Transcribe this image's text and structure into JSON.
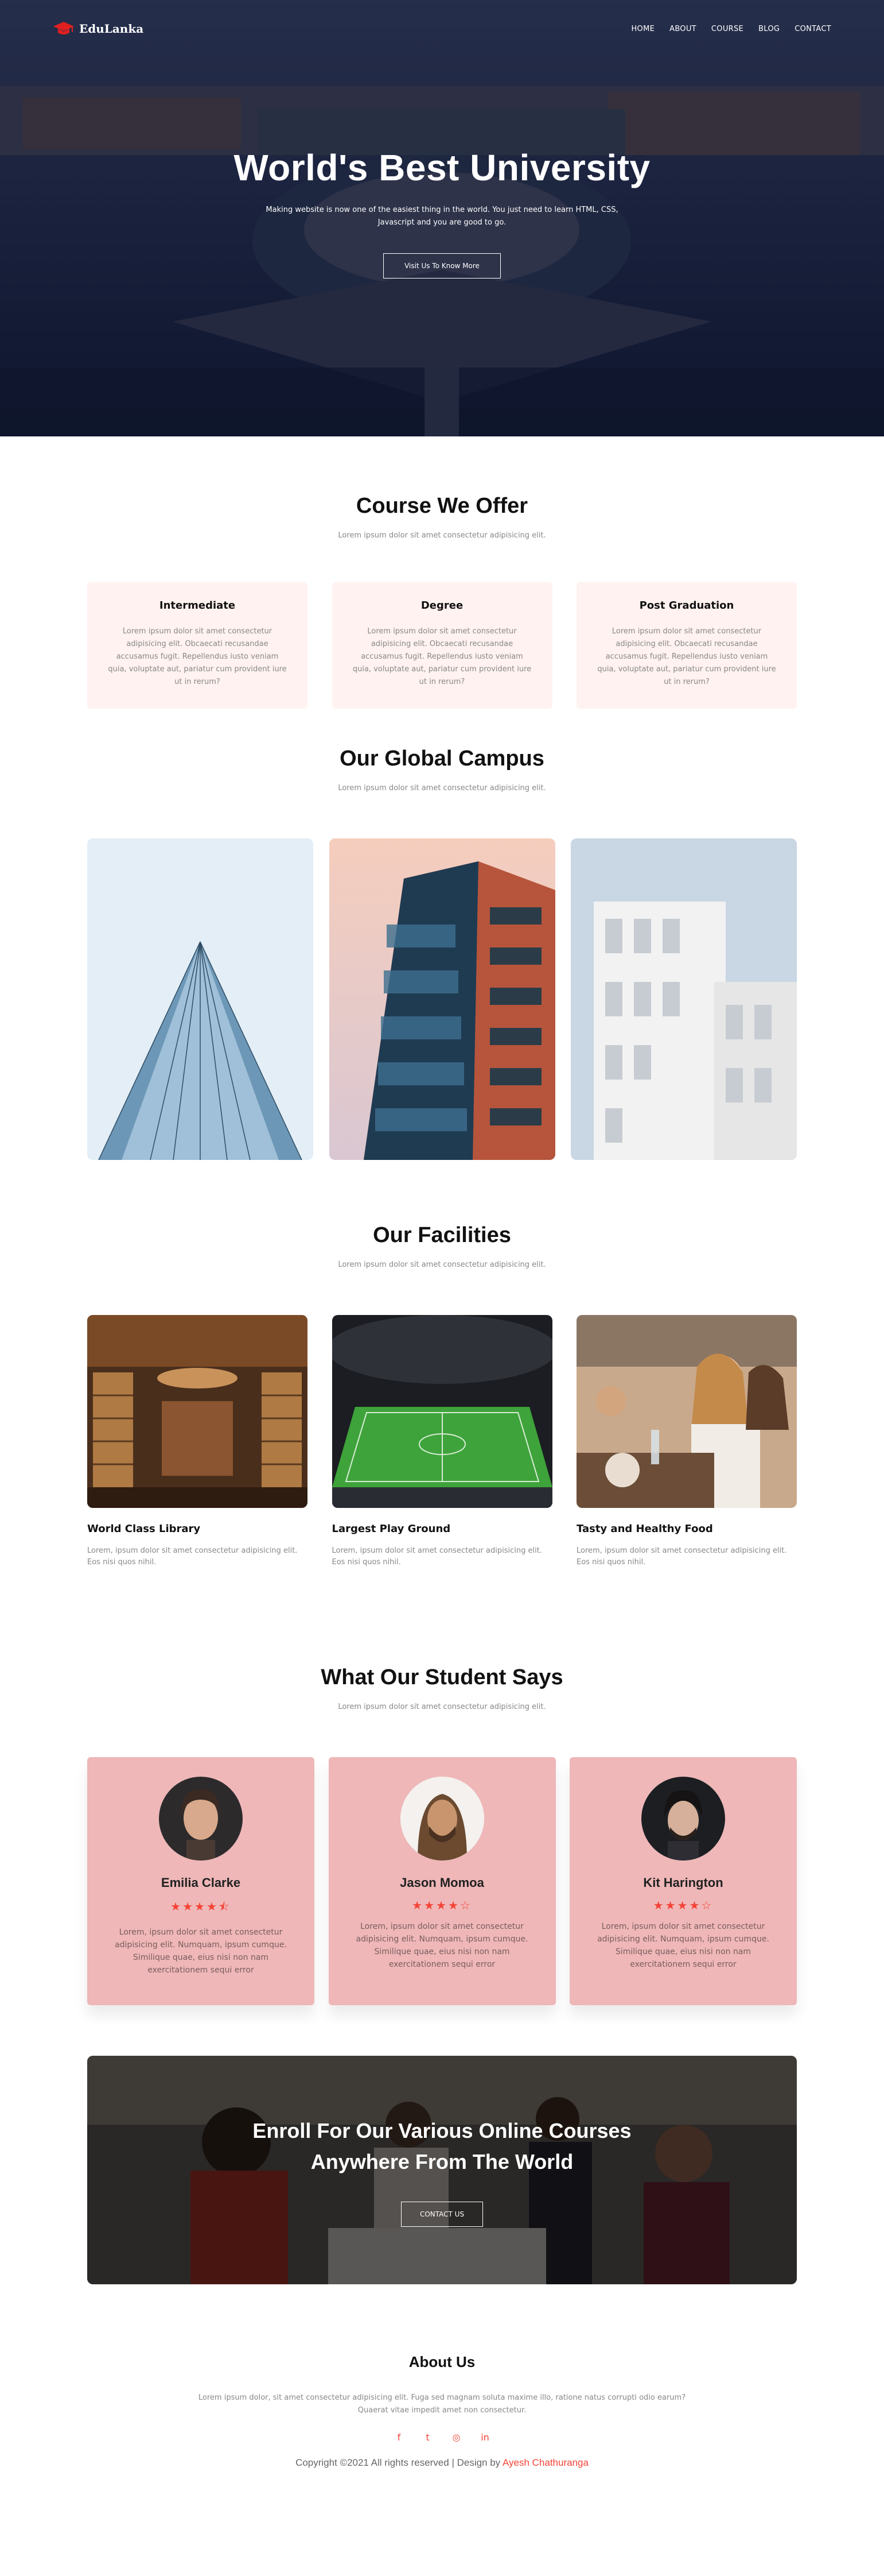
{
  "brand": {
    "name": "EduLanka",
    "accent_color": "#f44336",
    "icon": "graduation-cap-icon"
  },
  "nav": {
    "items": [
      "HOME",
      "ABOUT",
      "COURSE",
      "BLOG",
      "CONTACT"
    ]
  },
  "hero": {
    "title": "World's Best University",
    "subtitle": "Making website is now one of the easiest thing in the world. You just need to learn HTML, CSS, Javascript and you are good to go.",
    "button_label": "Visit Us To Know More"
  },
  "courses": {
    "title": "Course We Offer",
    "subtitle": "Lorem ipsum dolor sit amet consectetur adipisicing elit.",
    "cards": [
      {
        "name": "Intermediate",
        "text": "Lorem ipsum dolor sit amet consectetur adipisicing elit. Obcaecati recusandae accusamus fugit. Repellendus iusto veniam quia, voluptate aut, pariatur cum provident iure ut in rerum?"
      },
      {
        "name": "Degree",
        "text": "Lorem ipsum dolor sit amet consectetur adipisicing elit. Obcaecati recusandae accusamus fugit. Repellendus iusto veniam quia, voluptate aut, pariatur cum provident iure ut in rerum?"
      },
      {
        "name": "Post Graduation",
        "text": "Lorem ipsum dolor sit amet consectetur adipisicing elit. Obcaecati recusandae accusamus fugit. Repellendus iusto veniam quia, voluptate aut, pariatur cum provident iure ut in rerum?"
      }
    ]
  },
  "campus": {
    "title": "Our Global Campus",
    "subtitle": "Lorem ipsum dolor sit amet consectetur adipisicing elit."
  },
  "facilities": {
    "title": "Our Facilities",
    "subtitle": "Lorem ipsum dolor sit amet consectetur adipisicing elit.",
    "cards": [
      {
        "name": "World Class Library",
        "text": "Lorem, ipsum dolor sit amet consectetur adipisicing elit. Eos nisi quos nihil."
      },
      {
        "name": "Largest Play Ground",
        "text": "Lorem, ipsum dolor sit amet consectetur adipisicing elit. Eos nisi quos nihil."
      },
      {
        "name": "Tasty and Healthy Food",
        "text": "Lorem, ipsum dolor sit amet consectetur adipisicing elit. Eos nisi quos nihil."
      }
    ]
  },
  "testimonials": {
    "title": "What Our Student Says",
    "subtitle": "Lorem ipsum dolor sit amet consectetur adipisicing elit.",
    "cards": [
      {
        "name": "Emilia Clarke",
        "stars": "★★★★⯪",
        "rating": 4.5,
        "text": "Lorem, ipsum dolor sit amet consectetur adipisicing elit. Numquam, ipsum cumque. Similique quae, eius nisi non nam exercitationem sequi error"
      },
      {
        "name": "Jason Momoa",
        "stars": "★★★★☆",
        "rating": 4,
        "text": "Lorem, ipsum dolor sit amet consectetur adipisicing elit. Numquam, ipsum cumque. Similique quae, eius nisi non nam exercitationem sequi error"
      },
      {
        "name": "Kit Harington",
        "stars": "★★★★☆",
        "rating": 4,
        "text": "Lorem, ipsum dolor sit amet consectetur adipisicing elit. Numquam, ipsum cumque. Similique quae, eius nisi non nam exercitationem sequi error"
      }
    ]
  },
  "cta": {
    "title": "Enroll For Our Various Online Courses Anywhere From The World",
    "button_label": "CONTACT US"
  },
  "about": {
    "title": "About Us",
    "text": "Lorem ipsum dolor, sit amet consectetur adipisicing elit. Fuga sed magnam soluta maxime illo, ratione natus corrupti odio earum? Quaerat vitae impedit amet non consectetur.",
    "socials": [
      {
        "icon": "facebook-icon",
        "glyph": "f"
      },
      {
        "icon": "twitter-icon",
        "glyph": "t"
      },
      {
        "icon": "instagram-icon",
        "glyph": "◎"
      },
      {
        "icon": "linkedin-icon",
        "glyph": "in"
      }
    ],
    "copyright_prefix": "Copyright ©2021 All rights reserved | Design by ",
    "author": "Ayesh Chathuranga"
  }
}
